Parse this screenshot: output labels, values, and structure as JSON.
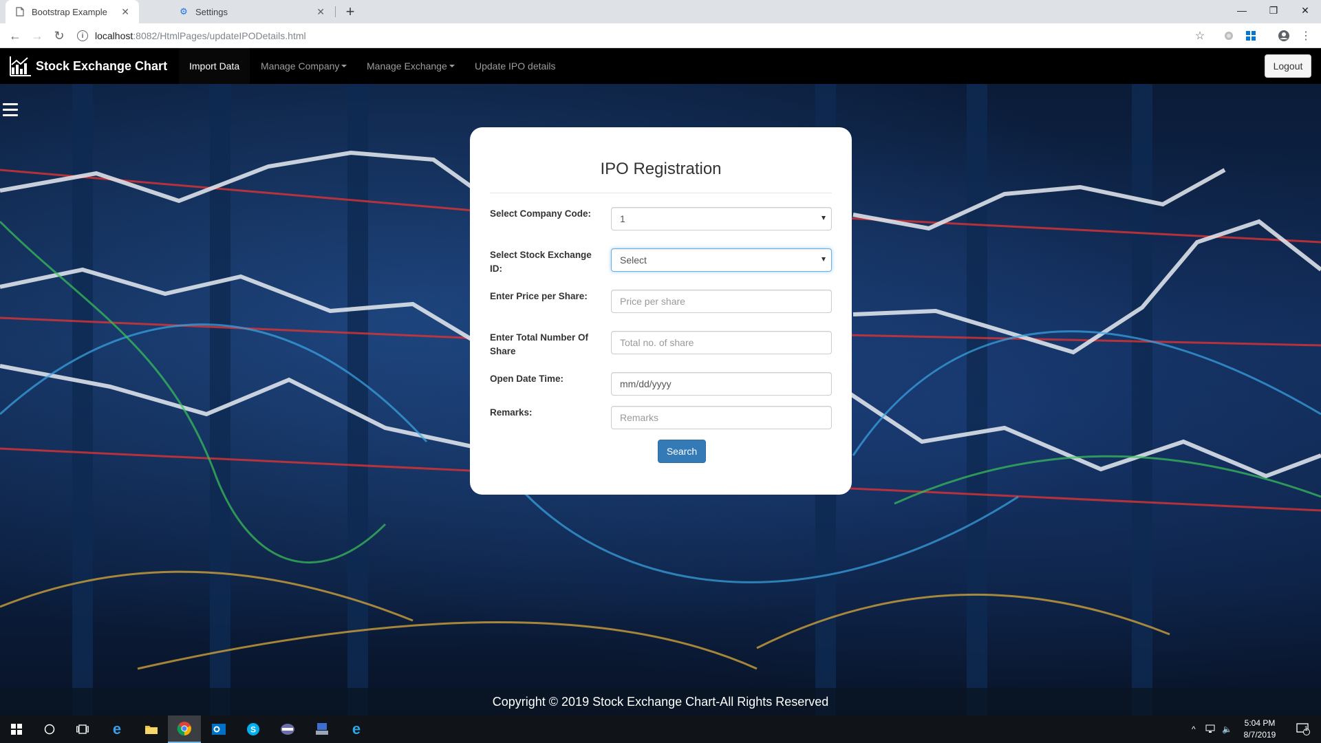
{
  "browser": {
    "tabs": [
      {
        "title": "Bootstrap Example",
        "icon": "page-icon",
        "active": true
      },
      {
        "title": "Settings",
        "icon": "gear-icon",
        "active": false
      }
    ],
    "url_host": "localhost",
    "url_path": ":8082/HtmlPages/updateIPODetails.html"
  },
  "navbar": {
    "brand": "Stock Exchange Chart",
    "items": [
      {
        "label": "Import Data",
        "active": true
      },
      {
        "label": "Manage Company",
        "dropdown": true
      },
      {
        "label": "Manage Exchange",
        "dropdown": true
      },
      {
        "label": "Update IPO details"
      }
    ],
    "logout_label": "Logout"
  },
  "form": {
    "title": "IPO Registration",
    "company_code": {
      "label": "Select Company Code:",
      "value": "1"
    },
    "exchange_id": {
      "label": "Select Stock Exchange ID:",
      "value": "Select"
    },
    "price": {
      "label": "Enter Price per Share:",
      "placeholder": "Price per share"
    },
    "total_shares": {
      "label": "Enter Total Number Of Share",
      "placeholder": "Total no. of share"
    },
    "open_date": {
      "label": "Open Date Time:",
      "value": "mm/dd/yyyy"
    },
    "remarks": {
      "label": "Remarks:",
      "placeholder": "Remarks"
    },
    "search_label": "Search"
  },
  "footer": {
    "text": "Copyright © 2019 Stock Exchange Chart-All Rights Reserved"
  },
  "taskbar": {
    "time": "5:04 PM",
    "date": "8/7/2019",
    "notification_count": "1"
  },
  "colors": {
    "navbar_bg": "#000000",
    "primary_button": "#337ab7",
    "focus_border": "#66afe9"
  }
}
